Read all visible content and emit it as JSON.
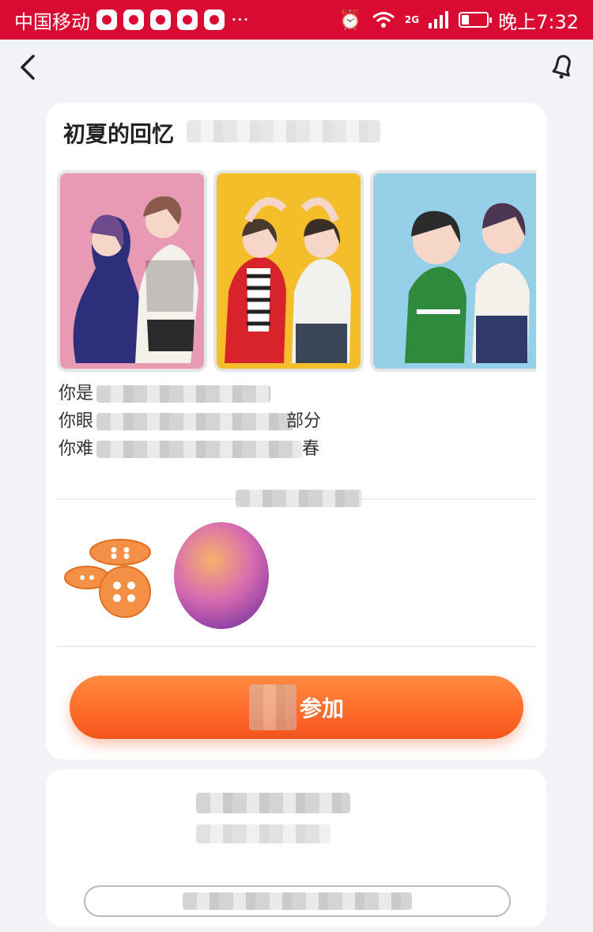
{
  "status_bar": {
    "carrier": "中国移动",
    "time": "晚上7:32",
    "signal_label": "2G",
    "overflow": "···"
  },
  "nav": {
    "back_icon": "chevron-left-icon",
    "right_icon": "bell-icon"
  },
  "event": {
    "title": "初夏的回忆",
    "description_lines": [
      {
        "start": "你是",
        "end": ""
      },
      {
        "start": "你眼",
        "end": "部分"
      },
      {
        "start": "你难",
        "end": "春"
      }
    ],
    "photos": [
      {
        "name": "couple-pink-background"
      },
      {
        "name": "couple-yellow-background"
      },
      {
        "name": "couple-blue-background"
      }
    ],
    "rewards": [
      {
        "name": "buttons-reward"
      },
      {
        "name": "avatar-frame-reward"
      }
    ],
    "join_button_label": "参加"
  },
  "colors": {
    "status_bar": "#d90b32",
    "join_button": "#ff6a2a",
    "page_background": "#f1f3f6"
  }
}
